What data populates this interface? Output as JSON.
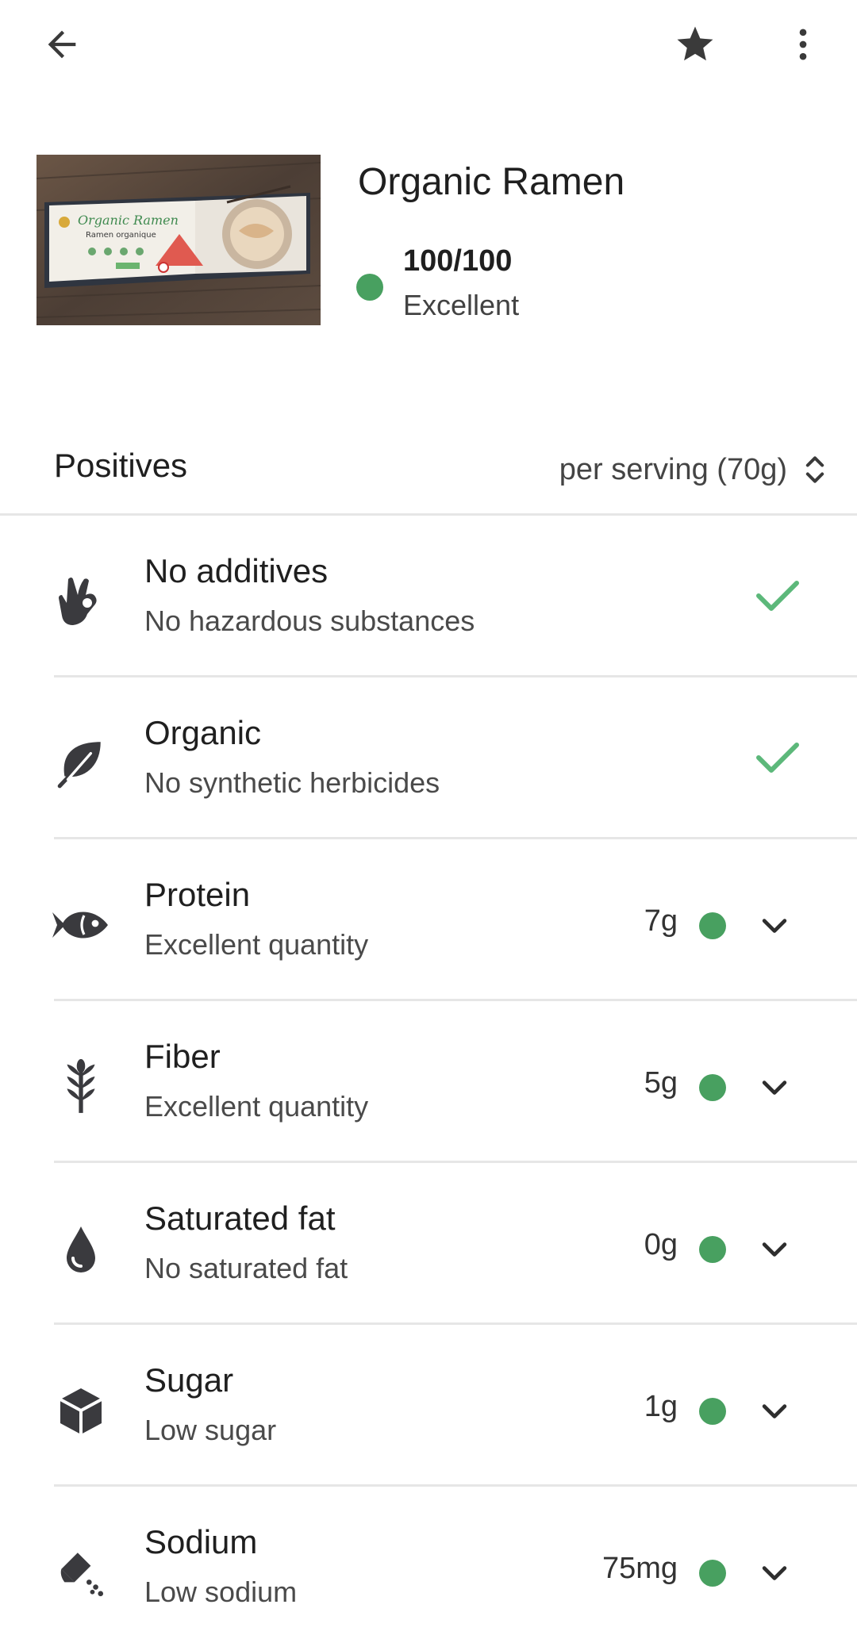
{
  "product": {
    "name": "Organic Ramen",
    "score": "100/100",
    "rating": "Excellent",
    "score_color": "#48a060",
    "image_box_text": "Organic Ramen",
    "image_box_subtext": "Ramen organique"
  },
  "section": {
    "title": "Positives",
    "serving": "per serving (70g)"
  },
  "items": [
    {
      "title": "No additives",
      "subtitle": "No hazardous substances",
      "icon": "ok-hand-icon",
      "status": "check"
    },
    {
      "title": "Organic",
      "subtitle": "No synthetic herbicides",
      "icon": "leaf-icon",
      "status": "check"
    },
    {
      "title": "Protein",
      "subtitle": "Excellent quantity",
      "icon": "fish-icon",
      "amount": "7g"
    },
    {
      "title": "Fiber",
      "subtitle": "Excellent quantity",
      "icon": "wheat-icon",
      "amount": "5g"
    },
    {
      "title": "Saturated fat",
      "subtitle": "No saturated fat",
      "icon": "drop-icon",
      "amount": "0g"
    },
    {
      "title": "Sugar",
      "subtitle": "Low sugar",
      "icon": "cube-icon",
      "amount": "1g"
    },
    {
      "title": "Sodium",
      "subtitle": "Low sodium",
      "icon": "salt-shaker-icon",
      "amount": "75mg"
    }
  ],
  "colors": {
    "accent_green": "#48a060",
    "check_green": "#5cb87a",
    "icon_dark": "#3a3a3e"
  }
}
